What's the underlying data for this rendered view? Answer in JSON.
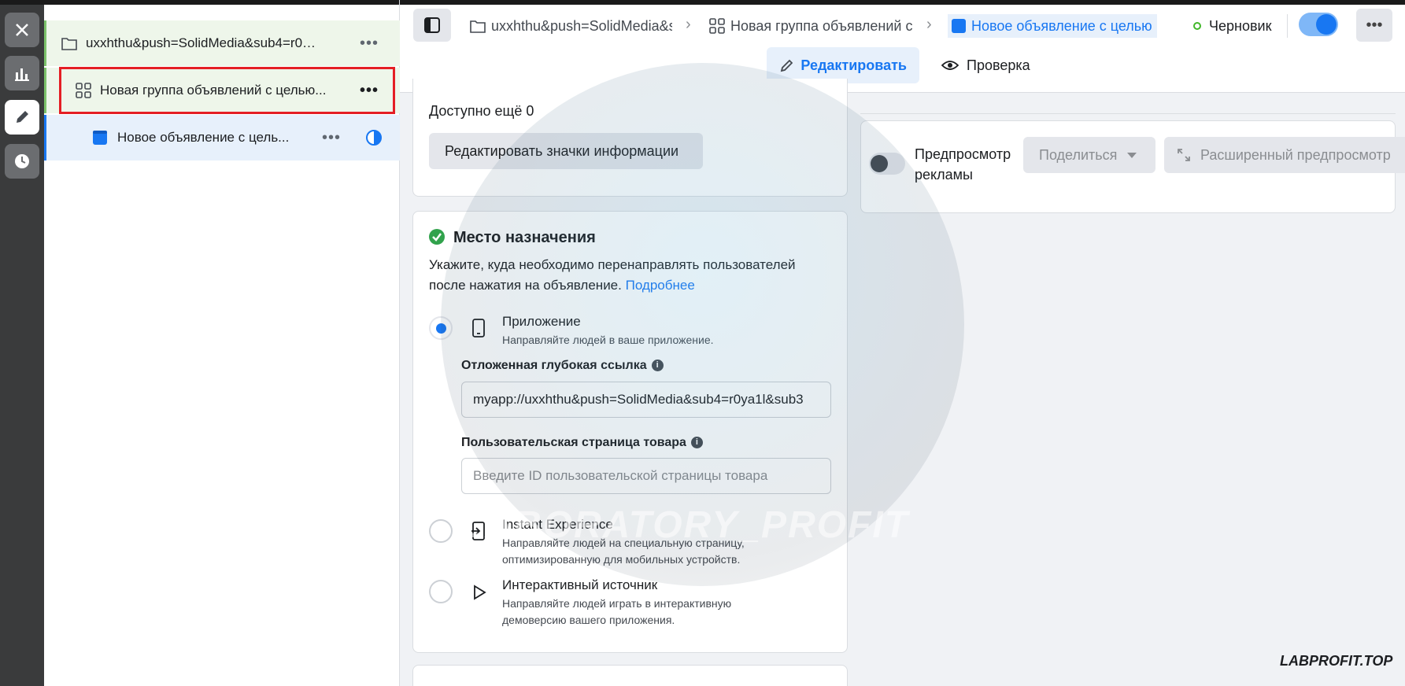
{
  "rail": {
    "close_icon": "close-icon",
    "chart_icon": "bar-chart-icon",
    "edit_icon": "pencil-icon",
    "history_icon": "clock-icon"
  },
  "tree": {
    "campaign": {
      "label": "uxxhthu&push=SolidMedia&sub4=r0ya...",
      "icon": "folder-icon",
      "more": "•••"
    },
    "adset": {
      "label": "Новая группа объявлений с целью...",
      "icon": "grid-icon",
      "more": "•••"
    },
    "ad": {
      "label": "Новое объявление с цель...",
      "icon": "ad-square-icon",
      "more": "•••"
    }
  },
  "header": {
    "crumbs": [
      {
        "label": "uxxhthu&push=SolidMedia&su"
      },
      {
        "label": "Новая группа объявлений с"
      },
      {
        "label": "Новое объявление с целью"
      }
    ],
    "status": "Черновик",
    "more": "•••",
    "tabs": {
      "edit": "Редактировать",
      "review": "Проверка"
    }
  },
  "info_card": {
    "available": "Доступно ещё 0",
    "edit_button": "Редактировать значки информации"
  },
  "destination": {
    "title": "Место назначения",
    "description_line1": "Укажите, куда необходимо перенаправлять пользователей",
    "description_line2": "после нажатия на объявление.",
    "learn_more": "Подробнее",
    "options": [
      {
        "title": "Приложение",
        "desc": "Направляйте людей в ваше приложение.",
        "selected": true
      },
      {
        "title": "Instant Experience",
        "desc1": "Направляйте людей на специальную страницу,",
        "desc2": "оптимизированную для мобильных устройств.",
        "selected": false
      },
      {
        "title": "Интерактивный источник",
        "desc1": "Направляйте людей играть в интерактивную",
        "desc2": "демоверсию вашего приложения.",
        "selected": false
      }
    ],
    "deeplink_label": "Отложенная глубокая ссылка",
    "deeplink_value": "myapp://uxxhthu&push=SolidMedia&sub4=r0ya1l&sub3",
    "product_page_label": "Пользовательская страница товара",
    "product_page_placeholder": "Введите ID пользовательской страницы товара"
  },
  "preview": {
    "label_line1": "Предпросмотр",
    "label_line2": "рекламы",
    "share": "Поделиться",
    "advanced": "Расширенный предпросмотр"
  },
  "watermark": "LABORATORY_PROFIT",
  "brand": "LABPROFIT.TOP"
}
